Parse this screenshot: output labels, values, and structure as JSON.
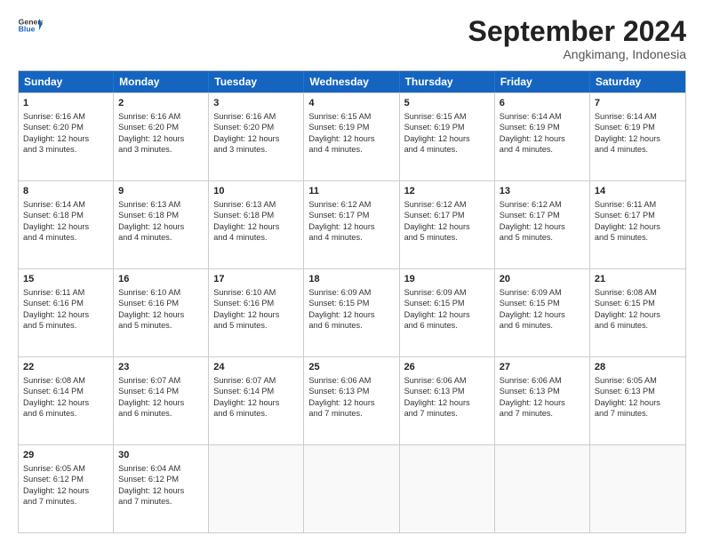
{
  "header": {
    "logo": {
      "general": "General",
      "blue": "Blue"
    },
    "title": "September 2024",
    "location": "Angkimang, Indonesia"
  },
  "calendar": {
    "days_of_week": [
      "Sunday",
      "Monday",
      "Tuesday",
      "Wednesday",
      "Thursday",
      "Friday",
      "Saturday"
    ],
    "weeks": [
      [
        {
          "day": null,
          "content": ""
        },
        {
          "day": null,
          "content": ""
        },
        {
          "day": null,
          "content": ""
        },
        {
          "day": null,
          "content": ""
        },
        {
          "day": "5",
          "sunrise": "Sunrise: 6:15 AM",
          "sunset": "Sunset: 6:19 PM",
          "daylight": "Daylight: 12 hours",
          "extra": "and 4 minutes."
        },
        {
          "day": "6",
          "sunrise": "Sunrise: 6:14 AM",
          "sunset": "Sunset: 6:19 PM",
          "daylight": "Daylight: 12 hours",
          "extra": "and 4 minutes."
        },
        {
          "day": "7",
          "sunrise": "Sunrise: 6:14 AM",
          "sunset": "Sunset: 6:19 PM",
          "daylight": "Daylight: 12 hours",
          "extra": "and 4 minutes."
        }
      ],
      [
        {
          "day": "1",
          "sunrise": "Sunrise: 6:16 AM",
          "sunset": "Sunset: 6:20 PM",
          "daylight": "Daylight: 12 hours",
          "extra": "and 3 minutes."
        },
        {
          "day": "2",
          "sunrise": "Sunrise: 6:16 AM",
          "sunset": "Sunset: 6:20 PM",
          "daylight": "Daylight: 12 hours",
          "extra": "and 3 minutes."
        },
        {
          "day": "3",
          "sunrise": "Sunrise: 6:16 AM",
          "sunset": "Sunset: 6:20 PM",
          "daylight": "Daylight: 12 hours",
          "extra": "and 3 minutes."
        },
        {
          "day": "4",
          "sunrise": "Sunrise: 6:15 AM",
          "sunset": "Sunset: 6:19 PM",
          "daylight": "Daylight: 12 hours",
          "extra": "and 4 minutes."
        },
        {
          "day": "5",
          "sunrise": "Sunrise: 6:15 AM",
          "sunset": "Sunset: 6:19 PM",
          "daylight": "Daylight: 12 hours",
          "extra": "and 4 minutes."
        },
        {
          "day": "6",
          "sunrise": "Sunrise: 6:14 AM",
          "sunset": "Sunset: 6:19 PM",
          "daylight": "Daylight: 12 hours",
          "extra": "and 4 minutes."
        },
        {
          "day": "7",
          "sunrise": "Sunrise: 6:14 AM",
          "sunset": "Sunset: 6:19 PM",
          "daylight": "Daylight: 12 hours",
          "extra": "and 4 minutes."
        }
      ],
      [
        {
          "day": "8",
          "sunrise": "Sunrise: 6:14 AM",
          "sunset": "Sunset: 6:18 PM",
          "daylight": "Daylight: 12 hours",
          "extra": "and 4 minutes."
        },
        {
          "day": "9",
          "sunrise": "Sunrise: 6:13 AM",
          "sunset": "Sunset: 6:18 PM",
          "daylight": "Daylight: 12 hours",
          "extra": "and 4 minutes."
        },
        {
          "day": "10",
          "sunrise": "Sunrise: 6:13 AM",
          "sunset": "Sunset: 6:18 PM",
          "daylight": "Daylight: 12 hours",
          "extra": "and 4 minutes."
        },
        {
          "day": "11",
          "sunrise": "Sunrise: 6:12 AM",
          "sunset": "Sunset: 6:17 PM",
          "daylight": "Daylight: 12 hours",
          "extra": "and 4 minutes."
        },
        {
          "day": "12",
          "sunrise": "Sunrise: 6:12 AM",
          "sunset": "Sunset: 6:17 PM",
          "daylight": "Daylight: 12 hours",
          "extra": "and 5 minutes."
        },
        {
          "day": "13",
          "sunrise": "Sunrise: 6:12 AM",
          "sunset": "Sunset: 6:17 PM",
          "daylight": "Daylight: 12 hours",
          "extra": "and 5 minutes."
        },
        {
          "day": "14",
          "sunrise": "Sunrise: 6:11 AM",
          "sunset": "Sunset: 6:17 PM",
          "daylight": "Daylight: 12 hours",
          "extra": "and 5 minutes."
        }
      ],
      [
        {
          "day": "15",
          "sunrise": "Sunrise: 6:11 AM",
          "sunset": "Sunset: 6:16 PM",
          "daylight": "Daylight: 12 hours",
          "extra": "and 5 minutes."
        },
        {
          "day": "16",
          "sunrise": "Sunrise: 6:10 AM",
          "sunset": "Sunset: 6:16 PM",
          "daylight": "Daylight: 12 hours",
          "extra": "and 5 minutes."
        },
        {
          "day": "17",
          "sunrise": "Sunrise: 6:10 AM",
          "sunset": "Sunset: 6:16 PM",
          "daylight": "Daylight: 12 hours",
          "extra": "and 5 minutes."
        },
        {
          "day": "18",
          "sunrise": "Sunrise: 6:09 AM",
          "sunset": "Sunset: 6:15 PM",
          "daylight": "Daylight: 12 hours",
          "extra": "and 6 minutes."
        },
        {
          "day": "19",
          "sunrise": "Sunrise: 6:09 AM",
          "sunset": "Sunset: 6:15 PM",
          "daylight": "Daylight: 12 hours",
          "extra": "and 6 minutes."
        },
        {
          "day": "20",
          "sunrise": "Sunrise: 6:09 AM",
          "sunset": "Sunset: 6:15 PM",
          "daylight": "Daylight: 12 hours",
          "extra": "and 6 minutes."
        },
        {
          "day": "21",
          "sunrise": "Sunrise: 6:08 AM",
          "sunset": "Sunset: 6:15 PM",
          "daylight": "Daylight: 12 hours",
          "extra": "and 6 minutes."
        }
      ],
      [
        {
          "day": "22",
          "sunrise": "Sunrise: 6:08 AM",
          "sunset": "Sunset: 6:14 PM",
          "daylight": "Daylight: 12 hours",
          "extra": "and 6 minutes."
        },
        {
          "day": "23",
          "sunrise": "Sunrise: 6:07 AM",
          "sunset": "Sunset: 6:14 PM",
          "daylight": "Daylight: 12 hours",
          "extra": "and 6 minutes."
        },
        {
          "day": "24",
          "sunrise": "Sunrise: 6:07 AM",
          "sunset": "Sunset: 6:14 PM",
          "daylight": "Daylight: 12 hours",
          "extra": "and 6 minutes."
        },
        {
          "day": "25",
          "sunrise": "Sunrise: 6:06 AM",
          "sunset": "Sunset: 6:13 PM",
          "daylight": "Daylight: 12 hours",
          "extra": "and 7 minutes."
        },
        {
          "day": "26",
          "sunrise": "Sunrise: 6:06 AM",
          "sunset": "Sunset: 6:13 PM",
          "daylight": "Daylight: 12 hours",
          "extra": "and 7 minutes."
        },
        {
          "day": "27",
          "sunrise": "Sunrise: 6:06 AM",
          "sunset": "Sunset: 6:13 PM",
          "daylight": "Daylight: 12 hours",
          "extra": "and 7 minutes."
        },
        {
          "day": "28",
          "sunrise": "Sunrise: 6:05 AM",
          "sunset": "Sunset: 6:13 PM",
          "daylight": "Daylight: 12 hours",
          "extra": "and 7 minutes."
        }
      ],
      [
        {
          "day": "29",
          "sunrise": "Sunrise: 6:05 AM",
          "sunset": "Sunset: 6:12 PM",
          "daylight": "Daylight: 12 hours",
          "extra": "and 7 minutes."
        },
        {
          "day": "30",
          "sunrise": "Sunrise: 6:04 AM",
          "sunset": "Sunset: 6:12 PM",
          "daylight": "Daylight: 12 hours",
          "extra": "and 7 minutes."
        },
        {
          "day": null,
          "content": ""
        },
        {
          "day": null,
          "content": ""
        },
        {
          "day": null,
          "content": ""
        },
        {
          "day": null,
          "content": ""
        },
        {
          "day": null,
          "content": ""
        }
      ]
    ],
    "row1": [
      {
        "day": "1",
        "sunrise": "Sunrise: 6:16 AM",
        "sunset": "Sunset: 6:20 PM",
        "daylight": "Daylight: 12 hours",
        "extra": "and 3 minutes."
      },
      {
        "day": "2",
        "sunrise": "Sunrise: 6:16 AM",
        "sunset": "Sunset: 6:20 PM",
        "daylight": "Daylight: 12 hours",
        "extra": "and 3 minutes."
      },
      {
        "day": "3",
        "sunrise": "Sunrise: 6:16 AM",
        "sunset": "Sunset: 6:20 PM",
        "daylight": "Daylight: 12 hours",
        "extra": "and 3 minutes."
      },
      {
        "day": "4",
        "sunrise": "Sunrise: 6:15 AM",
        "sunset": "Sunset: 6:19 PM",
        "daylight": "Daylight: 12 hours",
        "extra": "and 4 minutes."
      },
      {
        "day": "5",
        "sunrise": "Sunrise: 6:15 AM",
        "sunset": "Sunset: 6:19 PM",
        "daylight": "Daylight: 12 hours",
        "extra": "and 4 minutes."
      },
      {
        "day": "6",
        "sunrise": "Sunrise: 6:14 AM",
        "sunset": "Sunset: 6:19 PM",
        "daylight": "Daylight: 12 hours",
        "extra": "and 4 minutes."
      },
      {
        "day": "7",
        "sunrise": "Sunrise: 6:14 AM",
        "sunset": "Sunset: 6:19 PM",
        "daylight": "Daylight: 12 hours",
        "extra": "and 4 minutes."
      }
    ]
  }
}
